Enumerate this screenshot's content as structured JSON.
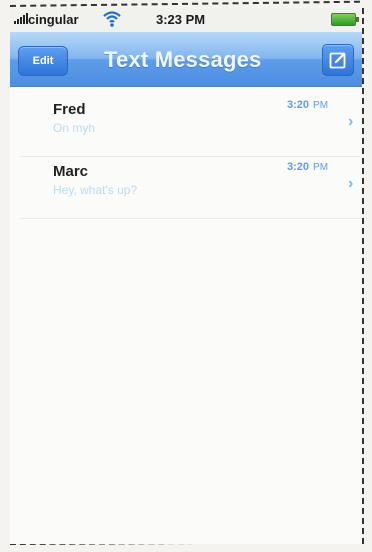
{
  "status_bar": {
    "carrier": "cingular",
    "time": "3:23 PM",
    "icons": [
      "signal-icon",
      "wifi-icon",
      "battery-icon"
    ]
  },
  "nav_bar": {
    "edit_label": "Edit",
    "title": "Text Messages",
    "compose_icon": "compose-icon"
  },
  "messages": [
    {
      "sender": "Fred",
      "preview": "On myh",
      "time": "3:20",
      "ampm": "PM"
    },
    {
      "sender": "Marc",
      "preview": "Hey, what's up?",
      "time": "3:20",
      "ampm": "PM"
    }
  ],
  "colors": {
    "nav_blue": "#4c8ee3",
    "accent": "#5b9df1",
    "preview": "#b8dcf7"
  }
}
